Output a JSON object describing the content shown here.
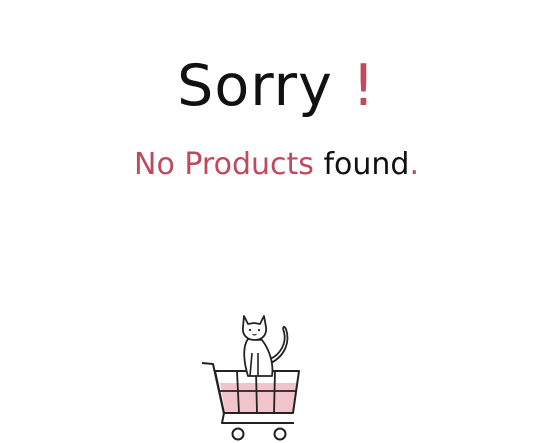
{
  "empty_state": {
    "title_word": "Sorry",
    "title_punct": "!",
    "subtitle_highlight": "No Products",
    "subtitle_rest": "found",
    "subtitle_punct": ".",
    "illustration_icon": "cat-in-shopping-cart-icon"
  },
  "colors": {
    "accent": "#c0495b",
    "text": "#111111",
    "cart_fill": "#f1c4cb"
  }
}
